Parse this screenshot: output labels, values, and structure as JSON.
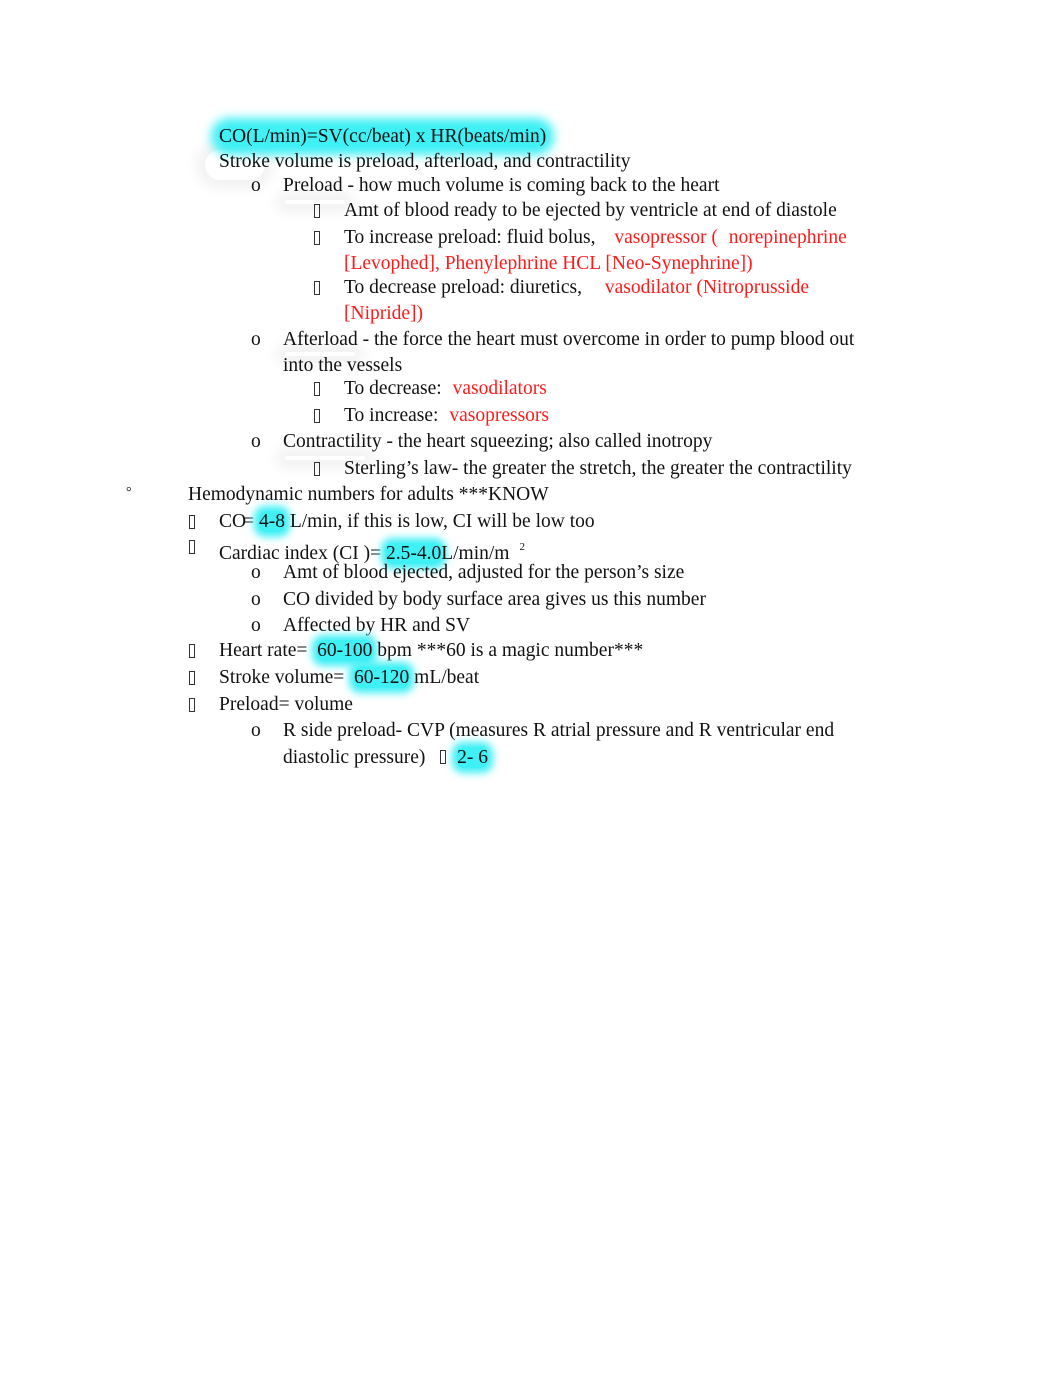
{
  "bullets": {
    "level2": "o",
    "level3_icon": "box-bullet",
    "level0": "°"
  },
  "colors": {
    "highlight": "#3ff0f5",
    "red_text": "#ff1a1a",
    "body_text": "#111111"
  },
  "section1": {
    "formula": "CO(L/min)=SV(cc/beat) x HR(beats/min)",
    "sv_intro": "Stroke volume is preload, afterload, and contractility",
    "preload": {
      "label": "Preload",
      "desc": " - how much volume is coming back to the heart",
      "items": [
        {
          "text": "Amt of blood ready to be ejected by ventricle at end of diastole"
        },
        {
          "text": "To increase preload: fluid bolus,",
          "red_1": "vasopressor (",
          "red_2": "norepinephrine",
          "red_cont": "[Levophed], Phenylephrine HCL [Neo-Synephrine])"
        },
        {
          "text": "To decrease preload: diuretics,",
          "red_1": "vasodilator (Nitroprusside",
          "red_cont": "[Nipride])"
        }
      ]
    },
    "afterload": {
      "label": "Afterload",
      "desc": " - the force the heart must overcome in order to pump blood out",
      "desc_cont": "into the vessels",
      "items": [
        {
          "text": "To decrease:",
          "red": "vasodilators"
        },
        {
          "text": "To increase:",
          "red": "vasopressors"
        }
      ]
    },
    "contractility": {
      "text": "Contractility - the heart squeezing; also called inotropy",
      "items": [
        {
          "text": "Sterling’s law- the greater the stretch, the greater the contractility"
        }
      ]
    }
  },
  "section2": {
    "heading": "Hemodynamic numbers for adults ***KNOW",
    "co": {
      "prefix": "CO",
      "eq": "= ",
      "value": "4-8",
      "suffix": " L/min, if this is low, CI will be low too"
    },
    "ci": {
      "prefix": "Cardiac index (CI )= ",
      "value": "2.5-4.0",
      "suffix": "L/min/m",
      "sup": "2",
      "items": [
        "Amt of blood ejected, adjusted for the person’s size",
        "CO divided by body surface area gives us this number",
        "Affected by HR and SV"
      ]
    },
    "hr": {
      "prefix": "Heart rate=  ",
      "value": "60-100",
      "suffix": " bpm ***60 is a magic number***"
    },
    "sv": {
      "prefix": "Stroke volume=  ",
      "value": "60-120",
      "suffix": " mL/beat"
    },
    "preload": {
      "text": "Preload= volume",
      "item_text": "R side preload- CVP (measures R atrial pressure and R ventricular end",
      "item_cont": "diastolic pressure)",
      "value": "2- 6"
    }
  }
}
